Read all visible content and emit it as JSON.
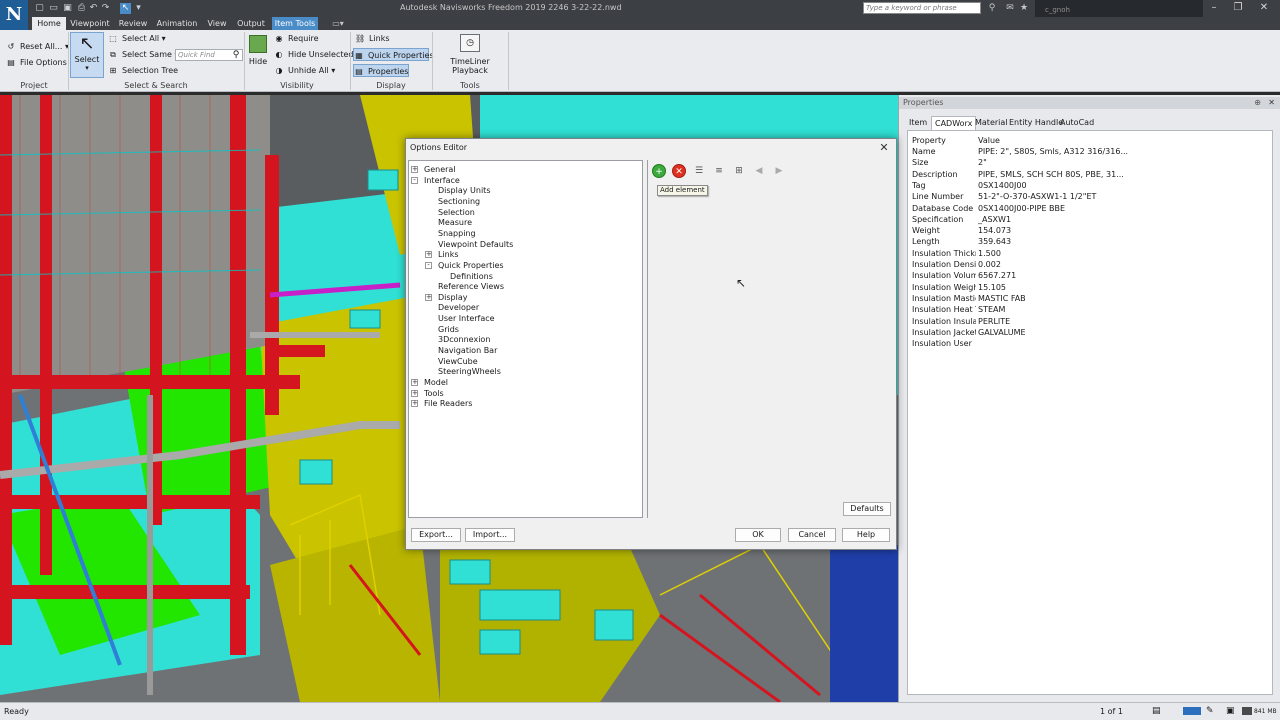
{
  "app": {
    "title": "Autodesk Navisworks Freedom 2019   2246 3-22-22.nwd",
    "logo_letter": "N",
    "search_placeholder": "Type a keyword or phrase",
    "user_name": "c_gnoh"
  },
  "tabs": [
    {
      "label": "Home"
    },
    {
      "label": "Viewpoint"
    },
    {
      "label": "Review"
    },
    {
      "label": "Animation"
    },
    {
      "label": "View"
    },
    {
      "label": "Output"
    },
    {
      "label": "Item Tools"
    }
  ],
  "ribbon": {
    "project": {
      "title": "Project",
      "reset_all": "Reset All...",
      "file_options": "File Options"
    },
    "select_search": {
      "title": "Select & Search",
      "select": "Select",
      "select_all": "Select All",
      "select_same": "Select Same",
      "selection_tree": "Selection Tree",
      "quick_find_placeholder": "Quick Find"
    },
    "visibility": {
      "title": "Visibility",
      "hide": "Hide",
      "require": "Require",
      "hide_unselected": "Hide Unselected",
      "unhide_all": "Unhide All"
    },
    "display": {
      "title": "Display",
      "links": "Links",
      "quick_properties": "Quick Properties",
      "properties": "Properties"
    },
    "tools": {
      "title": "Tools",
      "timeliner_playback": "TimeLiner Playback"
    }
  },
  "properties_panel": {
    "title": "Properties",
    "tabs": [
      "Item",
      "CADWorx",
      "Material",
      "Entity Handle",
      "AutoCad"
    ],
    "active_tab": "CADWorx",
    "columns": {
      "property": "Property",
      "value": "Value"
    },
    "rows": [
      {
        "property": "Name",
        "value": "PIPE: 2\", S80S, Smls, A312 316/316..."
      },
      {
        "property": "Size",
        "value": "2\""
      },
      {
        "property": "Description",
        "value": "PIPE, SMLS, SCH SCH 80S, PBE, 31..."
      },
      {
        "property": "Tag",
        "value": "0SX1400J00"
      },
      {
        "property": "Line Number",
        "value": "51-2\"-O-370-ASXW1-1 1/2\"ET"
      },
      {
        "property": "Database Code",
        "value": "0SX1400J00-PIPE BBE"
      },
      {
        "property": "Specification",
        "value": "_ASXW1"
      },
      {
        "property": "Weight",
        "value": "154.073"
      },
      {
        "property": "Length",
        "value": "359.643"
      },
      {
        "property": "Insulation Thickn...",
        "value": "1.500"
      },
      {
        "property": "Insulation Density",
        "value": "0.002"
      },
      {
        "property": "Insulation Volume",
        "value": "6567.271"
      },
      {
        "property": "Insulation Weight",
        "value": "15.105"
      },
      {
        "property": "Insulation Mastic",
        "value": "MASTIC FAB"
      },
      {
        "property": "Insulation Heat T...",
        "value": "STEAM"
      },
      {
        "property": "Insulation Insulati...",
        "value": "PERLITE"
      },
      {
        "property": "Insulation Jacketi...",
        "value": "GALVALUME"
      },
      {
        "property": "Insulation User",
        "value": ""
      }
    ]
  },
  "dialog": {
    "title": "Options Editor",
    "tree": [
      {
        "label": "General",
        "level": 0,
        "expander": "+"
      },
      {
        "label": "Interface",
        "level": 0,
        "expander": "-"
      },
      {
        "label": "Display Units",
        "level": 1,
        "expander": ""
      },
      {
        "label": "Sectioning",
        "level": 1,
        "expander": ""
      },
      {
        "label": "Selection",
        "level": 1,
        "expander": ""
      },
      {
        "label": "Measure",
        "level": 1,
        "expander": ""
      },
      {
        "label": "Snapping",
        "level": 1,
        "expander": ""
      },
      {
        "label": "Viewpoint Defaults",
        "level": 1,
        "expander": ""
      },
      {
        "label": "Links",
        "level": 1,
        "expander": "+"
      },
      {
        "label": "Quick Properties",
        "level": 1,
        "expander": "-"
      },
      {
        "label": "Definitions",
        "level": 2,
        "expander": ""
      },
      {
        "label": "Reference Views",
        "level": 1,
        "expander": ""
      },
      {
        "label": "Display",
        "level": 1,
        "expander": "+"
      },
      {
        "label": "Developer",
        "level": 1,
        "expander": ""
      },
      {
        "label": "User Interface",
        "level": 1,
        "expander": ""
      },
      {
        "label": "Grids",
        "level": 1,
        "expander": ""
      },
      {
        "label": "3Dconnexion",
        "level": 1,
        "expander": ""
      },
      {
        "label": "Navigation Bar",
        "level": 1,
        "expander": ""
      },
      {
        "label": "ViewCube",
        "level": 1,
        "expander": ""
      },
      {
        "label": "SteeringWheels",
        "level": 1,
        "expander": ""
      },
      {
        "label": "Model",
        "level": 0,
        "expander": "+"
      },
      {
        "label": "Tools",
        "level": 0,
        "expander": "+"
      },
      {
        "label": "File Readers",
        "level": 0,
        "expander": "+"
      }
    ],
    "tooltip": "Add element",
    "defaults_label": "Defaults",
    "export_label": "Export...",
    "import_label": "Import...",
    "ok_label": "OK",
    "cancel_label": "Cancel",
    "help_label": "Help"
  },
  "status": {
    "left": "Ready",
    "page": "1 of 1",
    "memory": "841 MB"
  },
  "colors": {
    "accent": "#4a8cc7",
    "ribbon_bg": "#e9ebee",
    "titlebar": "#3c3f44"
  }
}
